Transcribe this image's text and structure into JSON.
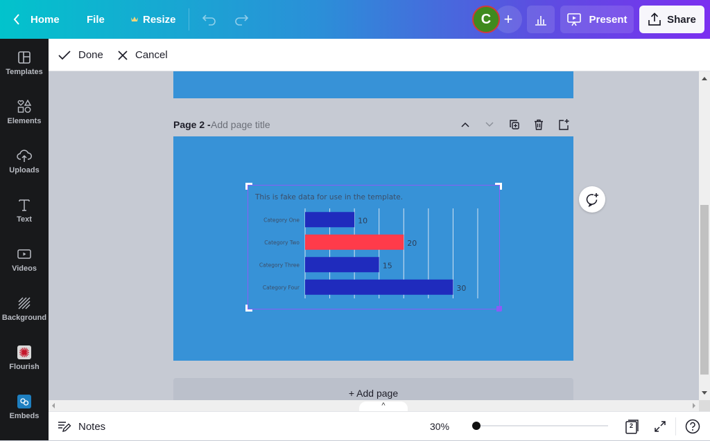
{
  "topbar": {
    "home_label": "Home",
    "file_label": "File",
    "resize_label": "Resize",
    "avatar_initial": "C",
    "present_label": "Present",
    "share_label": "Share",
    "colors": {
      "avatar_bg": "#3f8a1e",
      "avatar_ring": "#d23a3a"
    }
  },
  "editbar": {
    "done_label": "Done",
    "cancel_label": "Cancel"
  },
  "sidebar": {
    "items": [
      {
        "label": "Templates",
        "icon": "templates-icon"
      },
      {
        "label": "Elements",
        "icon": "elements-icon"
      },
      {
        "label": "Uploads",
        "icon": "uploads-icon"
      },
      {
        "label": "Text",
        "icon": "text-icon"
      },
      {
        "label": "Videos",
        "icon": "videos-icon"
      },
      {
        "label": "Background",
        "icon": "background-icon"
      },
      {
        "label": "Flourish",
        "icon": "flourish-icon"
      },
      {
        "label": "Embeds",
        "icon": "embeds-icon"
      }
    ]
  },
  "page": {
    "page_label": "Page 2 -",
    "title_placeholder": "Add page title",
    "add_page_label": "+ Add page",
    "background_color": "#3792d7"
  },
  "footer": {
    "notes_label": "Notes",
    "zoom_level": "30%",
    "zoom_slider_fraction": 0.0,
    "page_count": "2"
  },
  "chart_data": {
    "type": "bar",
    "orientation": "horizontal",
    "title": "This is fake data for use in the template.",
    "categories": [
      "Category One",
      "Category Two",
      "Category Three",
      "Category Four"
    ],
    "values": [
      10,
      20,
      15,
      30
    ],
    "bar_colors": [
      "#1f2bbd",
      "#ff3b4a",
      "#1f2bbd",
      "#1f2bbd"
    ],
    "xlim": [
      0,
      35
    ],
    "grid_step": 5,
    "grid": true,
    "data_labels": [
      "10",
      "20",
      "15",
      "30"
    ],
    "xlabel": "",
    "ylabel": ""
  }
}
